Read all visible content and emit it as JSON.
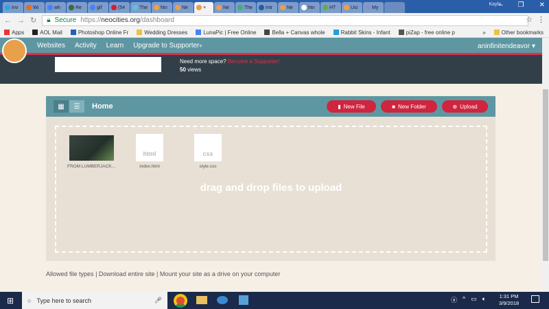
{
  "browser": {
    "tabs": [
      {
        "label": "Inv",
        "color": "#2aa7e0"
      },
      {
        "label": "Wi",
        "color": "#e07020"
      },
      {
        "label": "wh",
        "color": "#4285f4"
      },
      {
        "label": "Re",
        "color": "#3a6a3a"
      },
      {
        "label": "gif",
        "color": "#4285f4"
      },
      {
        "label": "(54",
        "color": "#d02030"
      },
      {
        "label": "The",
        "color": "#60c0e0"
      },
      {
        "label": "htn",
        "color": "#f0a040"
      },
      {
        "label": "Ne",
        "color": "#e8a04a"
      },
      {
        "label": "×",
        "color": "#e8a04a",
        "active": true
      },
      {
        "label": "Ne",
        "color": "#e8a04a"
      },
      {
        "label": "The",
        "color": "#40b070"
      },
      {
        "label": "Intr",
        "color": "#2060a0"
      },
      {
        "label": "Ne",
        "color": "#e8a04a"
      },
      {
        "label": "htn",
        "color": "#ffffff"
      },
      {
        "label": "HT",
        "color": "#60b040"
      },
      {
        "label": "Usi",
        "color": "#f0a040"
      },
      {
        "label": "My",
        "color": "#9090c0"
      }
    ],
    "user": "Kayla",
    "secure_label": "Secure",
    "url_scheme": "https://",
    "url_host": "neocities.org",
    "url_path": "/dashboard",
    "bookmarks": [
      "Apps",
      "AOL Mail",
      "Photoshop Online Fr",
      "Wedding Dresses",
      "LunaPic | Free Online",
      "Bella + Canvas whole",
      "Rabbit Skins - Infant",
      "piZap - free online p"
    ],
    "more": "»",
    "other_bookmarks": "Other bookmarks"
  },
  "nav": {
    "items": [
      "Websites",
      "Activity",
      "Learn",
      "Upgrade to Supporter"
    ],
    "account": "aninfinitendeavor"
  },
  "stats": {
    "need_space": "Need more space?",
    "become_supporter": "Become a Supporter!",
    "views": "50",
    "views_label": "views"
  },
  "files": {
    "title": "Home",
    "buttons": {
      "new_file": "New File",
      "new_folder": "New Folder",
      "upload": "Upload"
    },
    "items": [
      {
        "name": "FROM LUMBERJACK...",
        "type": "image"
      },
      {
        "name": "index.html",
        "type": "html"
      },
      {
        "name": "style.css",
        "type": "css"
      }
    ],
    "drop_text": "drag and drop files to upload"
  },
  "footer": {
    "allowed": "Allowed file types",
    "download": "Download entire site",
    "mount": "Mount your site as a drive on your computer",
    "sep": "|"
  },
  "taskbar": {
    "search_placeholder": "Type here to search",
    "time": "1:31 PM",
    "date": "3/9/2018"
  },
  "colors": {
    "accent": "#e0304c",
    "nav": "#5e97a2",
    "button": "#d0243f"
  }
}
